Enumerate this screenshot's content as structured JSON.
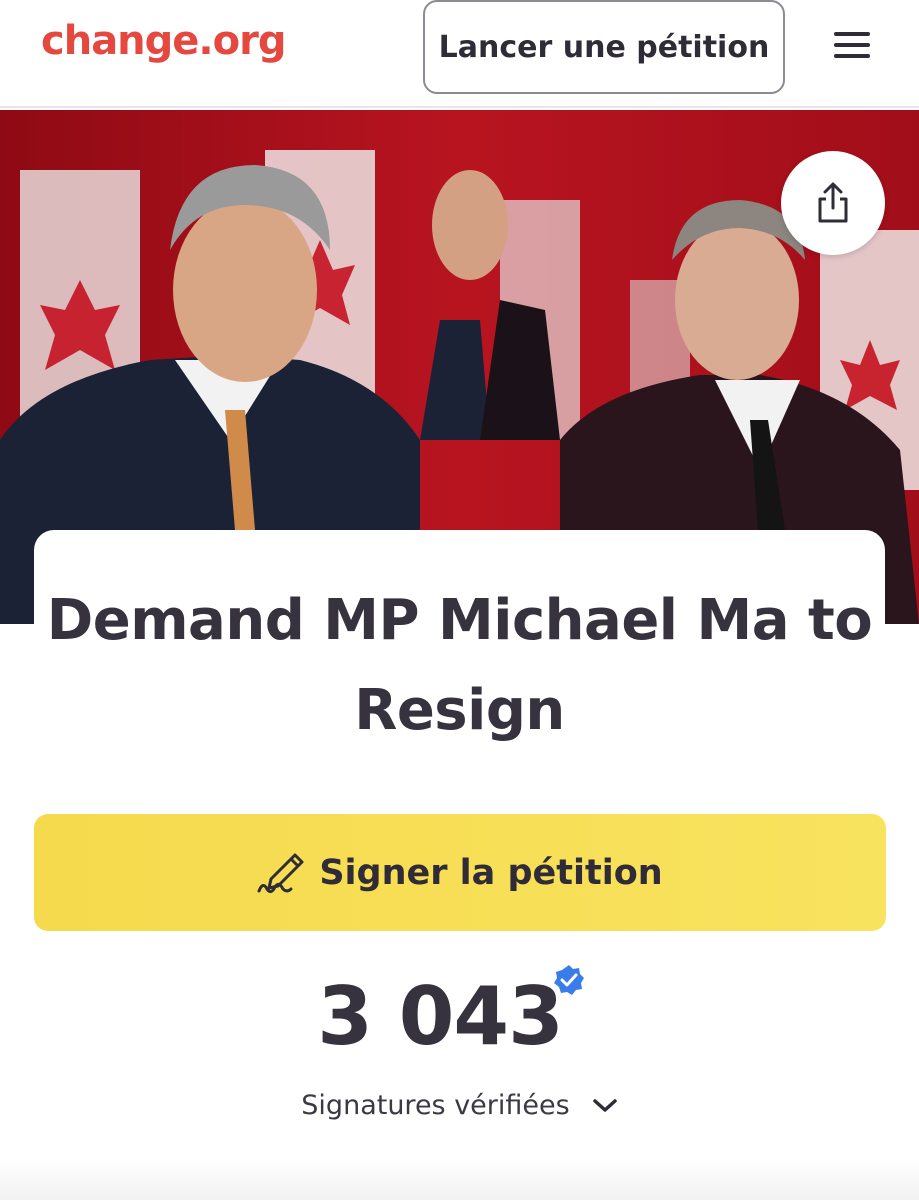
{
  "header": {
    "logo": "change.org",
    "start_label": "Lancer une pétition",
    "menu_icon": "menu-icon"
  },
  "hero": {
    "share_icon": "share-icon"
  },
  "petition": {
    "title": "Demand MP Michael Ma to Resign",
    "sign_label": "Signer la pétition",
    "sign_icon": "signature-pen-icon",
    "signature_count": "3 043",
    "signature_label": "Signatures vérifiées",
    "verified_icon": "verified-badge-icon",
    "chevron_icon": "chevron-down-icon"
  },
  "colors": {
    "brand": "#e5483e",
    "sign_button": "#f6da4d",
    "verified": "#3b7de8",
    "text": "#36333f"
  }
}
